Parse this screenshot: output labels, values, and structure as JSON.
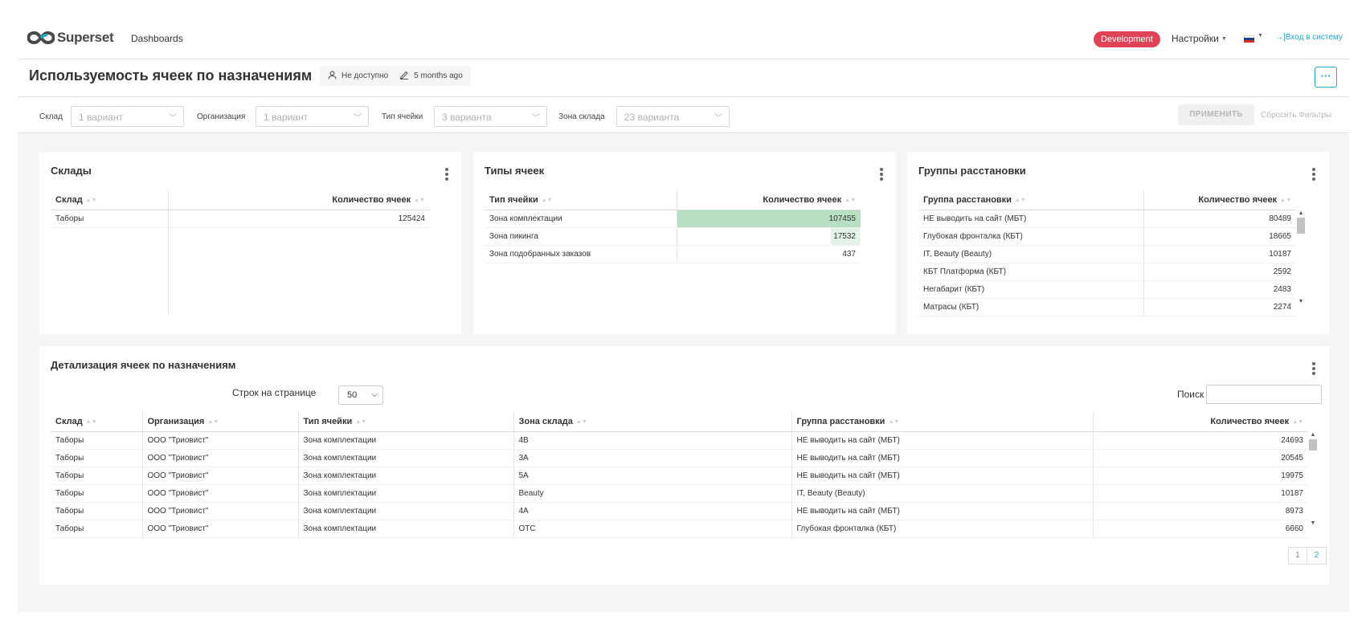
{
  "navbar": {
    "brand": "Superset",
    "dashboards_link": "Dashboards",
    "env_badge": "Development",
    "settings_label": "Настройки",
    "login_label": "→]Вход в систему"
  },
  "header": {
    "title": "Используемость ячеек по назначениям",
    "owner_text": "Не доступно",
    "modified_text": "5 months ago",
    "more_label": "···"
  },
  "filters": [
    {
      "label": "Склад",
      "value": "1 вариант"
    },
    {
      "label": "Организация",
      "value": "1 вариант"
    },
    {
      "label": "Тип ячейки",
      "value": "3 варианта"
    },
    {
      "label": "Зона склада",
      "value": "23 варианта"
    }
  ],
  "filter_actions": {
    "apply": "ПРИМЕНИТЬ",
    "reset": "Сбросить Фильтры"
  },
  "colors": {
    "accent": "#20a7c9",
    "badge": "#e04355",
    "bar_strong": "#b7dfc1",
    "bar_weak": "#edf7ef"
  },
  "cards": {
    "warehouses": {
      "title": "Склады",
      "columns": [
        "Склад",
        "Количество ячеек"
      ],
      "rows": [
        [
          "Таборы",
          "125424"
        ]
      ]
    },
    "cell_types": {
      "title": "Типы ячеек",
      "columns": [
        "Тип ячейки",
        "Количество ячеек"
      ],
      "rows": [
        [
          "Зона комплектации",
          "107455"
        ],
        [
          "Зона пикинга",
          "17532"
        ],
        [
          "Зона подобранных заказов",
          "437"
        ]
      ]
    },
    "placement_groups": {
      "title": "Группы расстановки",
      "columns": [
        "Группа расстановки",
        "Количество ячеек"
      ],
      "rows": [
        [
          "НЕ выводить на сайт (МБТ)",
          "80489"
        ],
        [
          "Глубокая фронталка (КБТ)",
          "18665"
        ],
        [
          "IT, Beauty (Beauty)",
          "10187"
        ],
        [
          "КБТ Платформа (КБТ)",
          "2592"
        ],
        [
          "Негабарит (КБТ)",
          "2483"
        ],
        [
          "Матрасы (КБТ)",
          "2274"
        ]
      ]
    }
  },
  "detail": {
    "title": "Детализация ячеек по назначениям",
    "rows_per_page_label": "Строк на странице",
    "rows_per_page_value": "50",
    "search_label": "Поиск",
    "columns": [
      "Склад",
      "Организация",
      "Тип ячейки",
      "Зона склада",
      "Группа расстановки",
      "Количество ячеек"
    ],
    "rows": [
      [
        "Таборы",
        "ООО \"Триовист\"",
        "Зона комплектации",
        "4B",
        "НЕ выводить на сайт (МБТ)",
        "24693"
      ],
      [
        "Таборы",
        "ООО \"Триовист\"",
        "Зона комплектации",
        "3A",
        "НЕ выводить на сайт (МБТ)",
        "20545"
      ],
      [
        "Таборы",
        "ООО \"Триовист\"",
        "Зона комплектации",
        "5A",
        "НЕ выводить на сайт (МБТ)",
        "19975"
      ],
      [
        "Таборы",
        "ООО \"Триовист\"",
        "Зона комплектации",
        "Beauty",
        "IT, Beauty (Beauty)",
        "10187"
      ],
      [
        "Таборы",
        "ООО \"Триовист\"",
        "Зона комплектации",
        "4A",
        "НЕ выводить на сайт (МБТ)",
        "8973"
      ],
      [
        "Таборы",
        "ООО \"Триовист\"",
        "Зона комплектации",
        "ОТС",
        "Глубокая фронталка (КБТ)",
        "6660"
      ]
    ],
    "pages": [
      "1",
      "2"
    ]
  }
}
